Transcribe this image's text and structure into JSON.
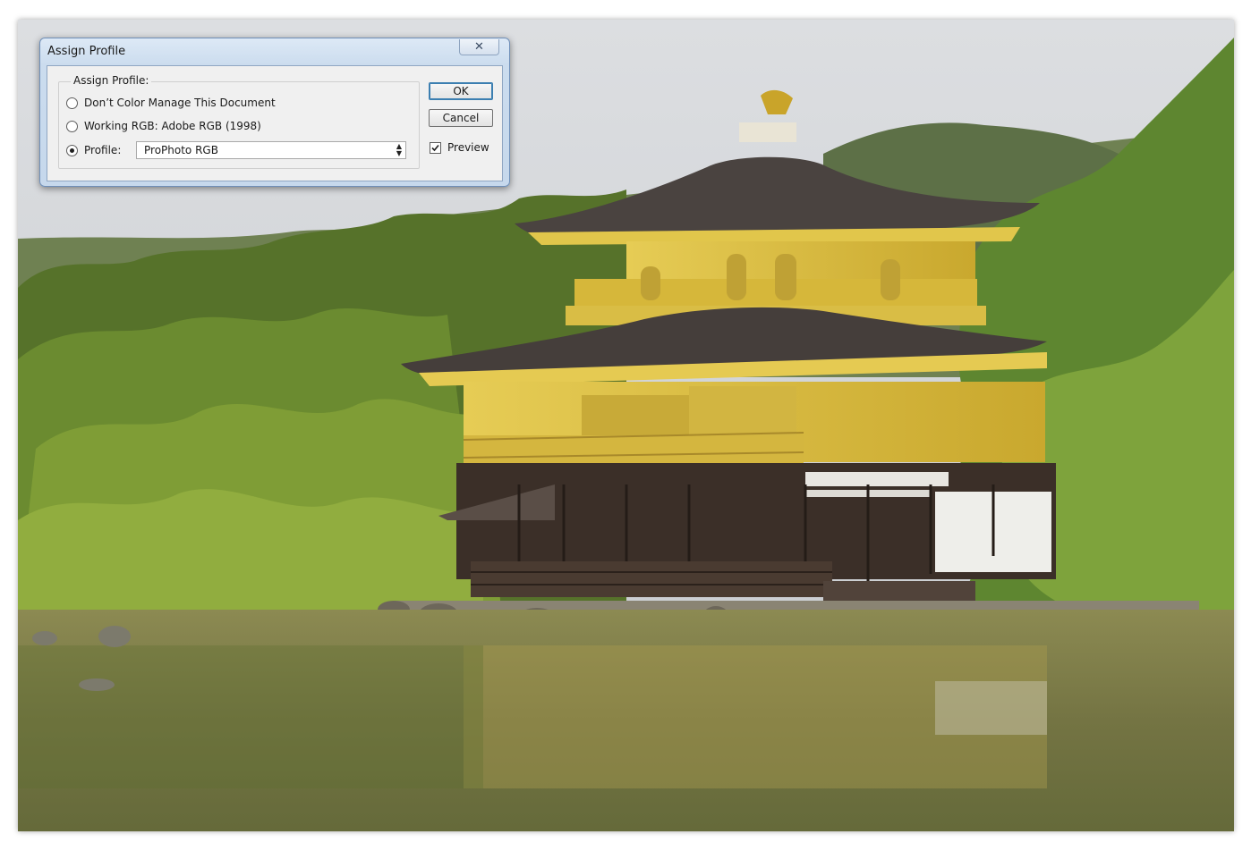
{
  "dialog": {
    "title": "Assign Profile",
    "close_glyph": "✕",
    "group_label": "Assign Profile:",
    "options": [
      {
        "label": "Don’t Color Manage This Document",
        "selected": false
      },
      {
        "label": "Working RGB:  Adobe RGB (1998)",
        "selected": false
      },
      {
        "label": "Profile:",
        "selected": true
      }
    ],
    "profile_value": "ProPhoto RGB",
    "ok_label": "OK",
    "cancel_label": "Cancel",
    "preview_label": "Preview",
    "preview_checked": true
  },
  "photo": {
    "subject": "golden-pavilion-photo",
    "colors": {
      "sky": "#c9ccd0",
      "gold": "#d9bc3c",
      "roof": "#4a4340",
      "trees": "#5e7a2e",
      "water": "#7d7a45"
    }
  }
}
